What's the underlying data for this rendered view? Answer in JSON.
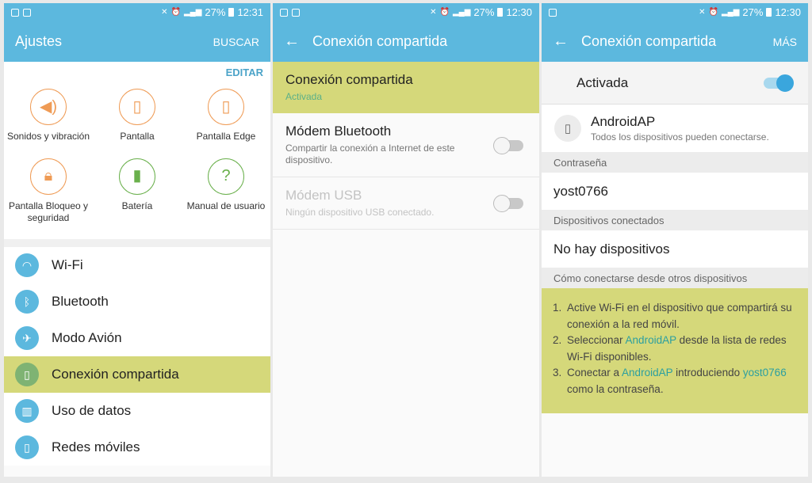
{
  "status": {
    "battery": "27%",
    "time1": "12:31",
    "time2": "12:30",
    "time3": "12:30"
  },
  "screen1": {
    "title": "Ajustes",
    "action": "BUSCAR",
    "edit": "EDITAR",
    "quick": [
      {
        "label": "Sonidos y vibración",
        "icon": "speaker-icon"
      },
      {
        "label": "Pantalla",
        "icon": "display-icon"
      },
      {
        "label": "Pantalla Edge",
        "icon": "edge-icon"
      },
      {
        "label": "Pantalla Bloqueo y seguridad",
        "icon": "lock-icon"
      },
      {
        "label": "Batería",
        "icon": "battery-icon"
      },
      {
        "label": "Manual de usuario",
        "icon": "manual-icon"
      }
    ],
    "list": [
      {
        "label": "Wi-Fi",
        "icon": "wifi-icon"
      },
      {
        "label": "Bluetooth",
        "icon": "bluetooth-icon"
      },
      {
        "label": "Modo Avión",
        "icon": "airplane-icon"
      },
      {
        "label": "Conexión compartida",
        "icon": "tethering-icon"
      },
      {
        "label": "Uso de datos",
        "icon": "data-usage-icon"
      },
      {
        "label": "Redes móviles",
        "icon": "mobile-networks-icon"
      }
    ]
  },
  "screen2": {
    "title": "Conexión compartida",
    "items": [
      {
        "title": "Conexión compartida",
        "sub": "Activada"
      },
      {
        "title": "Módem Bluetooth",
        "sub": "Compartir la conexión a Internet de este dispositivo."
      },
      {
        "title": "Módem USB",
        "sub": "Ningún dispositivo USB conectado."
      }
    ]
  },
  "screen3": {
    "title": "Conexión compartida",
    "action": "MÁS",
    "activated": "Activada",
    "ap_name": "AndroidAP",
    "ap_sub": "Todos los dispositivos pueden conectarse.",
    "pw_header": "Contraseña",
    "pw_value": "yost0766",
    "dev_header": "Dispositivos conectados",
    "dev_value": "No hay dispositivos",
    "how_header": "Cómo conectarse desde otros dispositivos",
    "steps": {
      "s1": "Active Wi-Fi en el dispositivo que compartirá su conexión a la red móvil.",
      "s2a": "Seleccionar ",
      "s2link": "AndroidAP",
      "s2b": " desde la lista de redes Wi-Fi disponibles.",
      "s3a": "Conectar a ",
      "s3link": "AndroidAP",
      "s3b": " introduciendo ",
      "s3pw": "yost0766",
      "s3c": " como la contraseña."
    }
  },
  "colors": {
    "appbar": "#5cb8de",
    "highlight": "#d5d87a",
    "accent": "#3aa6dd",
    "link": "#2b9fa0"
  }
}
